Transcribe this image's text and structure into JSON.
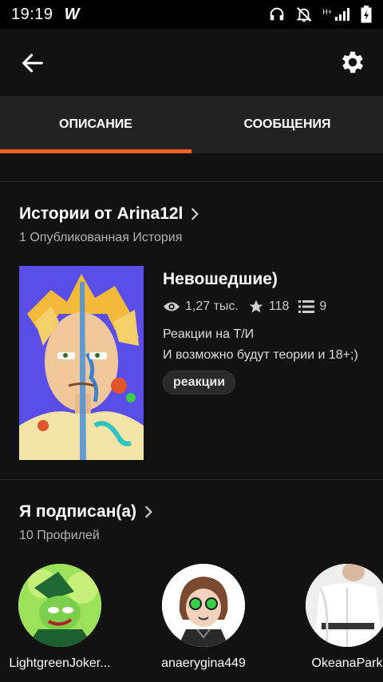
{
  "status_bar": {
    "time": "19:19",
    "app_logo": "W",
    "icons": [
      "headphones-icon",
      "bell-off-icon",
      "signal-icon",
      "battery-icon"
    ],
    "network_label": "H+"
  },
  "header": {
    "back_icon": "arrow-left-icon",
    "settings_icon": "gear-icon"
  },
  "tabs": [
    {
      "label": "ОПИСАНИЕ",
      "active": true
    },
    {
      "label": "СООБЩЕНИЯ",
      "active": false
    }
  ],
  "stories_section": {
    "title": "Истории от Arina12l",
    "subtitle": "1 Опубликованная История",
    "story": {
      "title": "Невошедшие)",
      "reads": "1,27 тыс.",
      "votes": "118",
      "parts": "9",
      "description_lines": [
        "Реакции на Т/И",
        "И возможно будут теории и 18+;)"
      ],
      "tag": "реакции"
    }
  },
  "following_section": {
    "title": "Я подписан(а)",
    "subtitle": "10 Профилей",
    "profiles": [
      {
        "name": "LightgreenJoker..."
      },
      {
        "name": "anaerygina449"
      },
      {
        "name": "OkeanaPark"
      }
    ]
  },
  "colors": {
    "accent": "#ff6122",
    "background": "#121212",
    "tab_bar": "#222222"
  }
}
